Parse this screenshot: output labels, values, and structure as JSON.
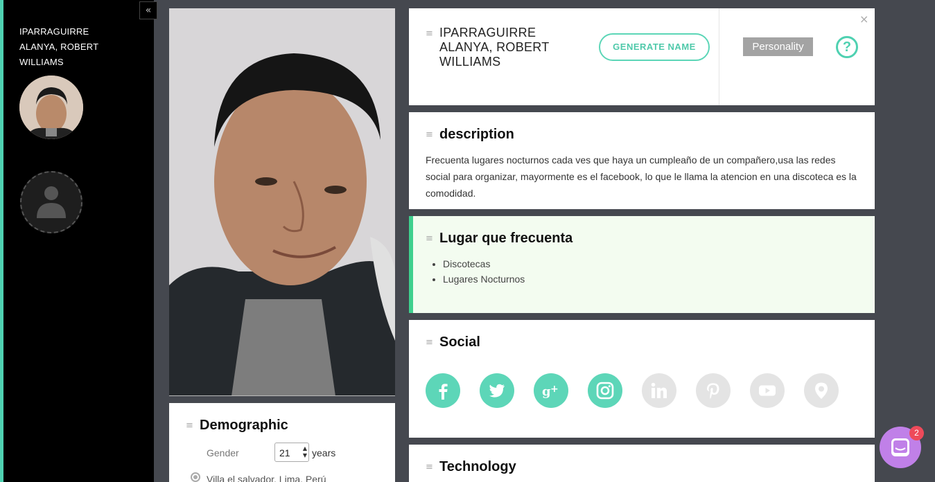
{
  "sidebar": {
    "collapse_icon": "«",
    "name": "IPARRAGUIRRE ALANYA, ROBERT WILLIAMS"
  },
  "header": {
    "name": "IPARRAGUIRRE ALANYA, ROBERT WILLIAMS",
    "generate_button": "GENERATE NAME",
    "personality_button": "Personality",
    "help_icon": "?",
    "close_icon": "×"
  },
  "description": {
    "title": "description",
    "text": " Frecuenta lugares nocturnos cada ves que haya un cumpleaño de un compañero,usa las redes social para organizar, mayormente es el facebook, lo que le llama la atencion en una discoteca es la comodidad."
  },
  "lugar": {
    "title": "Lugar que frecuenta",
    "items": [
      "Discotecas",
      "Lugares Nocturnos"
    ]
  },
  "social": {
    "title": "Social",
    "icons": [
      {
        "name": "facebook-icon",
        "color": "#5dd6b8",
        "active": true
      },
      {
        "name": "twitter-icon",
        "color": "#5dd6b8",
        "active": true
      },
      {
        "name": "google-plus-icon",
        "color": "#5dd6b8",
        "active": true
      },
      {
        "name": "instagram-icon",
        "color": "#5dd6b8",
        "active": true
      },
      {
        "name": "linkedin-icon",
        "color": "#e4e4e4",
        "active": false
      },
      {
        "name": "pinterest-icon",
        "color": "#e4e4e4",
        "active": false
      },
      {
        "name": "youtube-icon",
        "color": "#e4e4e4",
        "active": false
      },
      {
        "name": "periscope-icon",
        "color": "#e4e4e4",
        "active": false
      }
    ]
  },
  "technology": {
    "title": "Technology"
  },
  "demographic": {
    "title": "Demographic",
    "gender_label": "Gender",
    "age_value": "21",
    "age_unit": "years",
    "location": "Villa el salvador, Lima, Perú"
  },
  "chat": {
    "badge": "2"
  },
  "colors": {
    "accent": "#4fd1b1",
    "sidebar": "#000000",
    "page_bg": "#45484f",
    "highlight_bg": "#f3fcf0",
    "highlight_border": "#3fd08e"
  }
}
